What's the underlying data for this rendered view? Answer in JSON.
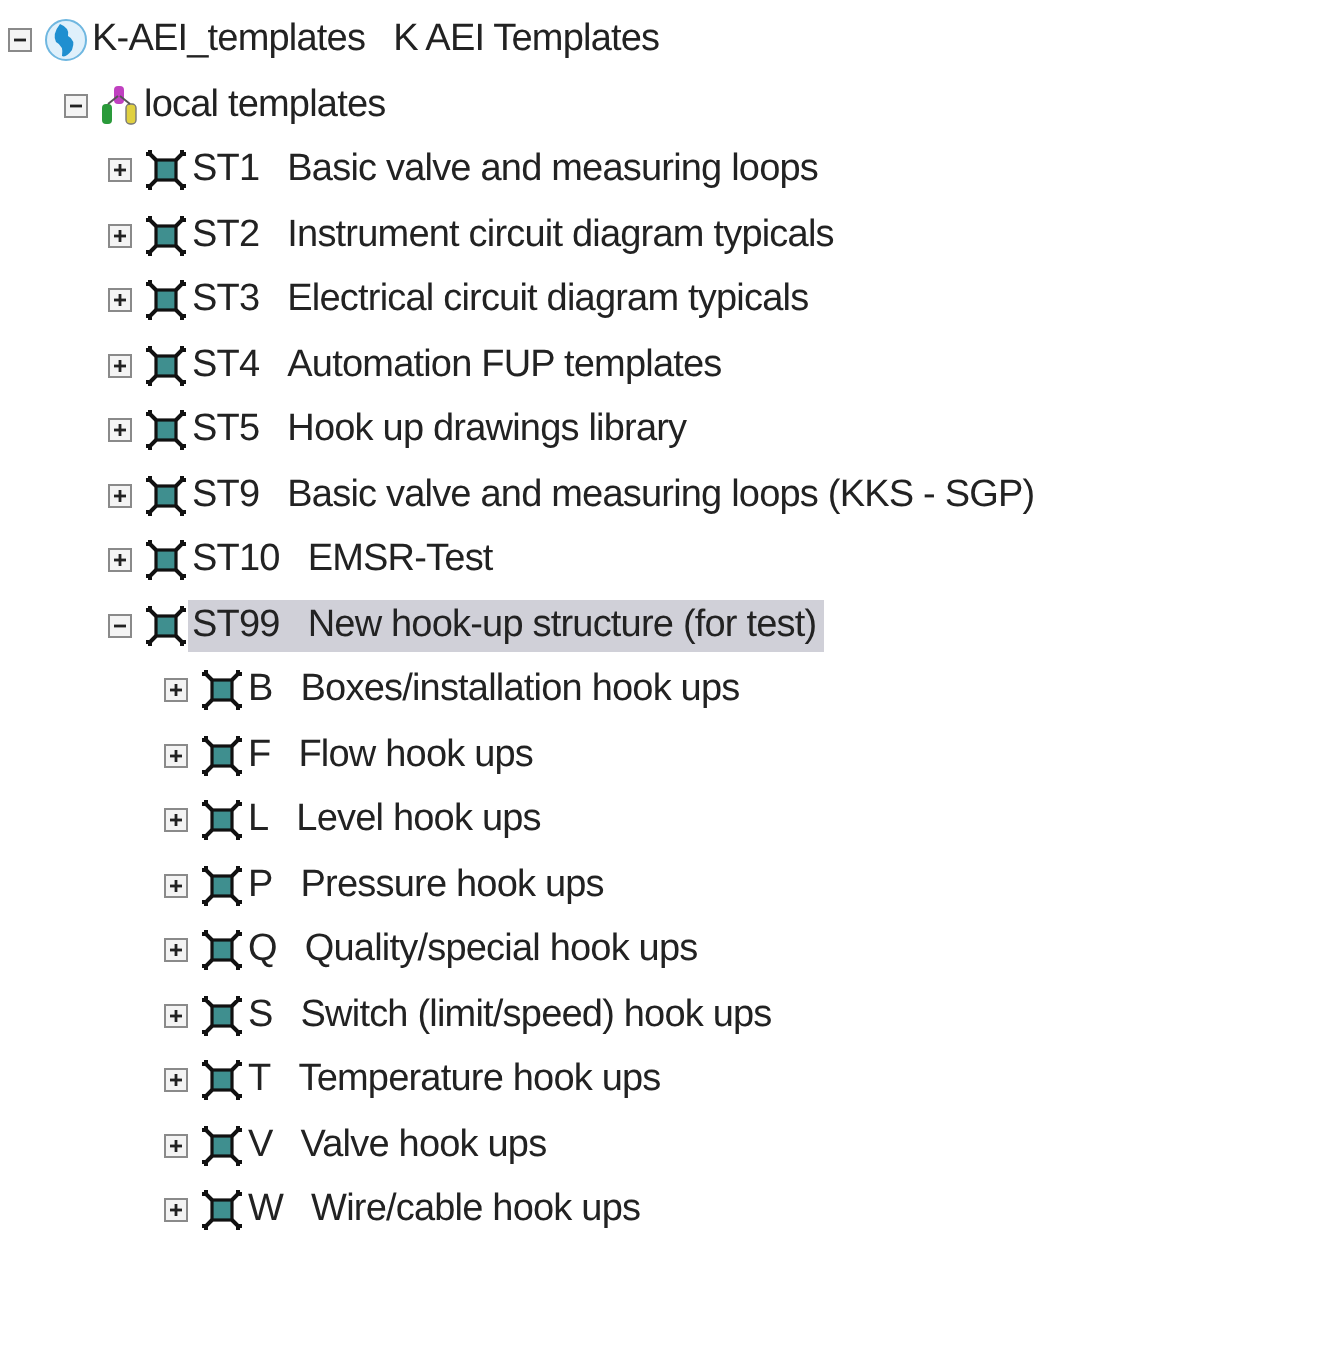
{
  "tree": [
    {
      "kind": "globe",
      "code": "K-AEI_templates",
      "label": "K AEI Templates",
      "expanded": true,
      "selected": false,
      "children": [
        {
          "kind": "library",
          "label": "local templates",
          "expanded": true,
          "selected": false,
          "children": [
            {
              "kind": "structure",
              "code": "ST1",
              "label": "Basic valve and measuring loops",
              "expanded": false,
              "selected": false
            },
            {
              "kind": "structure",
              "code": "ST2",
              "label": "Instrument circuit diagram typicals",
              "expanded": false,
              "selected": false
            },
            {
              "kind": "structure",
              "code": "ST3",
              "label": "Electrical circuit diagram typicals",
              "expanded": false,
              "selected": false
            },
            {
              "kind": "structure",
              "code": "ST4",
              "label": "Automation FUP templates",
              "expanded": false,
              "selected": false
            },
            {
              "kind": "structure",
              "code": "ST5",
              "label": "Hook up drawings library",
              "expanded": false,
              "selected": false
            },
            {
              "kind": "structure",
              "code": "ST9",
              "label": "Basic valve and measuring loops (KKS - SGP)",
              "expanded": false,
              "selected": false
            },
            {
              "kind": "structure",
              "code": "ST10",
              "label": "EMSR-Test",
              "expanded": false,
              "selected": false
            },
            {
              "kind": "structure",
              "code": "ST99",
              "label": "New hook-up structure (for test)",
              "expanded": true,
              "selected": true,
              "children": [
                {
                  "kind": "structure",
                  "code": "B",
                  "label": "Boxes/installation hook ups",
                  "expanded": false,
                  "selected": false
                },
                {
                  "kind": "structure",
                  "code": "F",
                  "label": "Flow hook ups",
                  "expanded": false,
                  "selected": false
                },
                {
                  "kind": "structure",
                  "code": "L",
                  "label": "Level hook ups",
                  "expanded": false,
                  "selected": false
                },
                {
                  "kind": "structure",
                  "code": "P",
                  "label": "Pressure hook ups",
                  "expanded": false,
                  "selected": false
                },
                {
                  "kind": "structure",
                  "code": "Q",
                  "label": "Quality/special hook ups",
                  "expanded": false,
                  "selected": false
                },
                {
                  "kind": "structure",
                  "code": "S",
                  "label": "Switch (limit/speed) hook ups",
                  "expanded": false,
                  "selected": false
                },
                {
                  "kind": "structure",
                  "code": "T",
                  "label": "Temperature hook ups",
                  "expanded": false,
                  "selected": false
                },
                {
                  "kind": "structure",
                  "code": "V",
                  "label": "Valve hook ups",
                  "expanded": false,
                  "selected": false
                },
                {
                  "kind": "structure",
                  "code": "W",
                  "label": "Wire/cable hook ups",
                  "expanded": false,
                  "selected": false
                }
              ]
            }
          ]
        }
      ]
    }
  ]
}
